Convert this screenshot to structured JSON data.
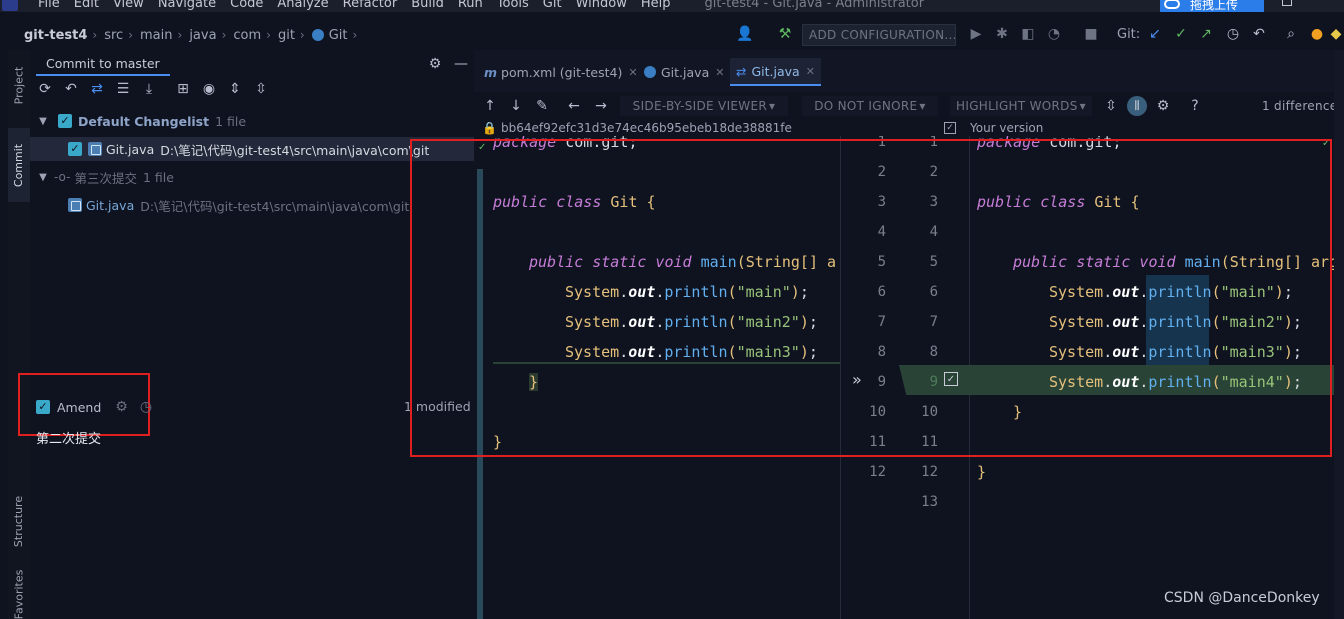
{
  "menu": [
    "File",
    "Edit",
    "View",
    "Navigate",
    "Code",
    "Analyze",
    "Refactor",
    "Build",
    "Run",
    "Tools",
    "Git",
    "Window",
    "Help"
  ],
  "window_title": "git-test4 - Git.java - Administrator",
  "baidu_button": "拖拽上传",
  "breadcrumb": [
    "git-test4",
    "src",
    "main",
    "java",
    "com",
    "git",
    "Git"
  ],
  "run_config": "ADD CONFIGURATION...",
  "git_label": "Git:",
  "side_tabs": {
    "project": "Project",
    "commit": "Commit",
    "structure": "Structure",
    "favorites": "Favorites"
  },
  "commit_panel": {
    "tab": "Commit to master",
    "changelist_name": "Default Changelist",
    "changelist_count": "1 file",
    "file_name": "Git.java",
    "file_path": "D:\\笔记\\代码\\git-test4\\src\\main\\java\\com\\git",
    "commit_group": "第三次提交",
    "commit_group_count": "1 file",
    "commit_file_name": "Git.java",
    "commit_file_path": "D:\\笔记\\代码\\git-test4\\src\\main\\java\\com\\git",
    "amend_label": "Amend",
    "amend_checked": true,
    "commit_message": "第二次提交",
    "modified": "1 modified"
  },
  "editor_tabs": [
    {
      "label": "pom.xml (git-test4)",
      "icon": "maven-icon"
    },
    {
      "label": "Git.java",
      "icon": "java-class-icon"
    },
    {
      "label": "Git.java",
      "icon": "diff-icon",
      "active": true
    }
  ],
  "diff_toolbar": {
    "viewer": "SIDE-BY-SIDE VIEWER",
    "ignore": "DO NOT IGNORE",
    "highlight": "HIGHLIGHT WORDS",
    "difference_count": "1 difference"
  },
  "left_revision": "bb64ef92efc31d3e74ec46b95ebeb18de38881fe",
  "right_revision": "Your version",
  "watermark": "CSDN @DanceDonkey",
  "colors": {
    "accent": "#4a8df0",
    "added": "#294436",
    "highlight_box": "#e02020"
  }
}
